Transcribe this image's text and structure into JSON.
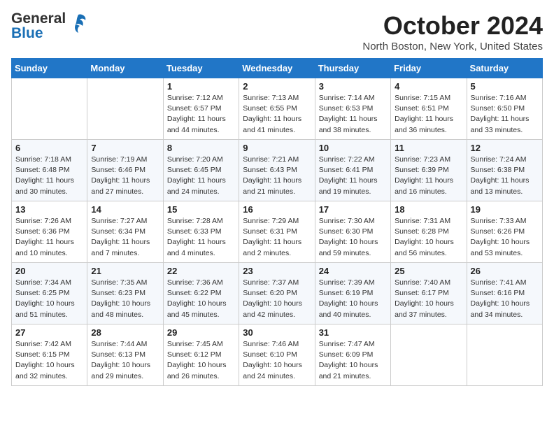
{
  "header": {
    "logo_line1": "General",
    "logo_line2": "Blue",
    "month": "October 2024",
    "location": "North Boston, New York, United States"
  },
  "days_of_week": [
    "Sunday",
    "Monday",
    "Tuesday",
    "Wednesday",
    "Thursday",
    "Friday",
    "Saturday"
  ],
  "weeks": [
    [
      {
        "day": "",
        "detail": ""
      },
      {
        "day": "",
        "detail": ""
      },
      {
        "day": "1",
        "detail": "Sunrise: 7:12 AM\nSunset: 6:57 PM\nDaylight: 11 hours and 44 minutes."
      },
      {
        "day": "2",
        "detail": "Sunrise: 7:13 AM\nSunset: 6:55 PM\nDaylight: 11 hours and 41 minutes."
      },
      {
        "day": "3",
        "detail": "Sunrise: 7:14 AM\nSunset: 6:53 PM\nDaylight: 11 hours and 38 minutes."
      },
      {
        "day": "4",
        "detail": "Sunrise: 7:15 AM\nSunset: 6:51 PM\nDaylight: 11 hours and 36 minutes."
      },
      {
        "day": "5",
        "detail": "Sunrise: 7:16 AM\nSunset: 6:50 PM\nDaylight: 11 hours and 33 minutes."
      }
    ],
    [
      {
        "day": "6",
        "detail": "Sunrise: 7:18 AM\nSunset: 6:48 PM\nDaylight: 11 hours and 30 minutes."
      },
      {
        "day": "7",
        "detail": "Sunrise: 7:19 AM\nSunset: 6:46 PM\nDaylight: 11 hours and 27 minutes."
      },
      {
        "day": "8",
        "detail": "Sunrise: 7:20 AM\nSunset: 6:45 PM\nDaylight: 11 hours and 24 minutes."
      },
      {
        "day": "9",
        "detail": "Sunrise: 7:21 AM\nSunset: 6:43 PM\nDaylight: 11 hours and 21 minutes."
      },
      {
        "day": "10",
        "detail": "Sunrise: 7:22 AM\nSunset: 6:41 PM\nDaylight: 11 hours and 19 minutes."
      },
      {
        "day": "11",
        "detail": "Sunrise: 7:23 AM\nSunset: 6:39 PM\nDaylight: 11 hours and 16 minutes."
      },
      {
        "day": "12",
        "detail": "Sunrise: 7:24 AM\nSunset: 6:38 PM\nDaylight: 11 hours and 13 minutes."
      }
    ],
    [
      {
        "day": "13",
        "detail": "Sunrise: 7:26 AM\nSunset: 6:36 PM\nDaylight: 11 hours and 10 minutes."
      },
      {
        "day": "14",
        "detail": "Sunrise: 7:27 AM\nSunset: 6:34 PM\nDaylight: 11 hours and 7 minutes."
      },
      {
        "day": "15",
        "detail": "Sunrise: 7:28 AM\nSunset: 6:33 PM\nDaylight: 11 hours and 4 minutes."
      },
      {
        "day": "16",
        "detail": "Sunrise: 7:29 AM\nSunset: 6:31 PM\nDaylight: 11 hours and 2 minutes."
      },
      {
        "day": "17",
        "detail": "Sunrise: 7:30 AM\nSunset: 6:30 PM\nDaylight: 10 hours and 59 minutes."
      },
      {
        "day": "18",
        "detail": "Sunrise: 7:31 AM\nSunset: 6:28 PM\nDaylight: 10 hours and 56 minutes."
      },
      {
        "day": "19",
        "detail": "Sunrise: 7:33 AM\nSunset: 6:26 PM\nDaylight: 10 hours and 53 minutes."
      }
    ],
    [
      {
        "day": "20",
        "detail": "Sunrise: 7:34 AM\nSunset: 6:25 PM\nDaylight: 10 hours and 51 minutes."
      },
      {
        "day": "21",
        "detail": "Sunrise: 7:35 AM\nSunset: 6:23 PM\nDaylight: 10 hours and 48 minutes."
      },
      {
        "day": "22",
        "detail": "Sunrise: 7:36 AM\nSunset: 6:22 PM\nDaylight: 10 hours and 45 minutes."
      },
      {
        "day": "23",
        "detail": "Sunrise: 7:37 AM\nSunset: 6:20 PM\nDaylight: 10 hours and 42 minutes."
      },
      {
        "day": "24",
        "detail": "Sunrise: 7:39 AM\nSunset: 6:19 PM\nDaylight: 10 hours and 40 minutes."
      },
      {
        "day": "25",
        "detail": "Sunrise: 7:40 AM\nSunset: 6:17 PM\nDaylight: 10 hours and 37 minutes."
      },
      {
        "day": "26",
        "detail": "Sunrise: 7:41 AM\nSunset: 6:16 PM\nDaylight: 10 hours and 34 minutes."
      }
    ],
    [
      {
        "day": "27",
        "detail": "Sunrise: 7:42 AM\nSunset: 6:15 PM\nDaylight: 10 hours and 32 minutes."
      },
      {
        "day": "28",
        "detail": "Sunrise: 7:44 AM\nSunset: 6:13 PM\nDaylight: 10 hours and 29 minutes."
      },
      {
        "day": "29",
        "detail": "Sunrise: 7:45 AM\nSunset: 6:12 PM\nDaylight: 10 hours and 26 minutes."
      },
      {
        "day": "30",
        "detail": "Sunrise: 7:46 AM\nSunset: 6:10 PM\nDaylight: 10 hours and 24 minutes."
      },
      {
        "day": "31",
        "detail": "Sunrise: 7:47 AM\nSunset: 6:09 PM\nDaylight: 10 hours and 21 minutes."
      },
      {
        "day": "",
        "detail": ""
      },
      {
        "day": "",
        "detail": ""
      }
    ]
  ]
}
